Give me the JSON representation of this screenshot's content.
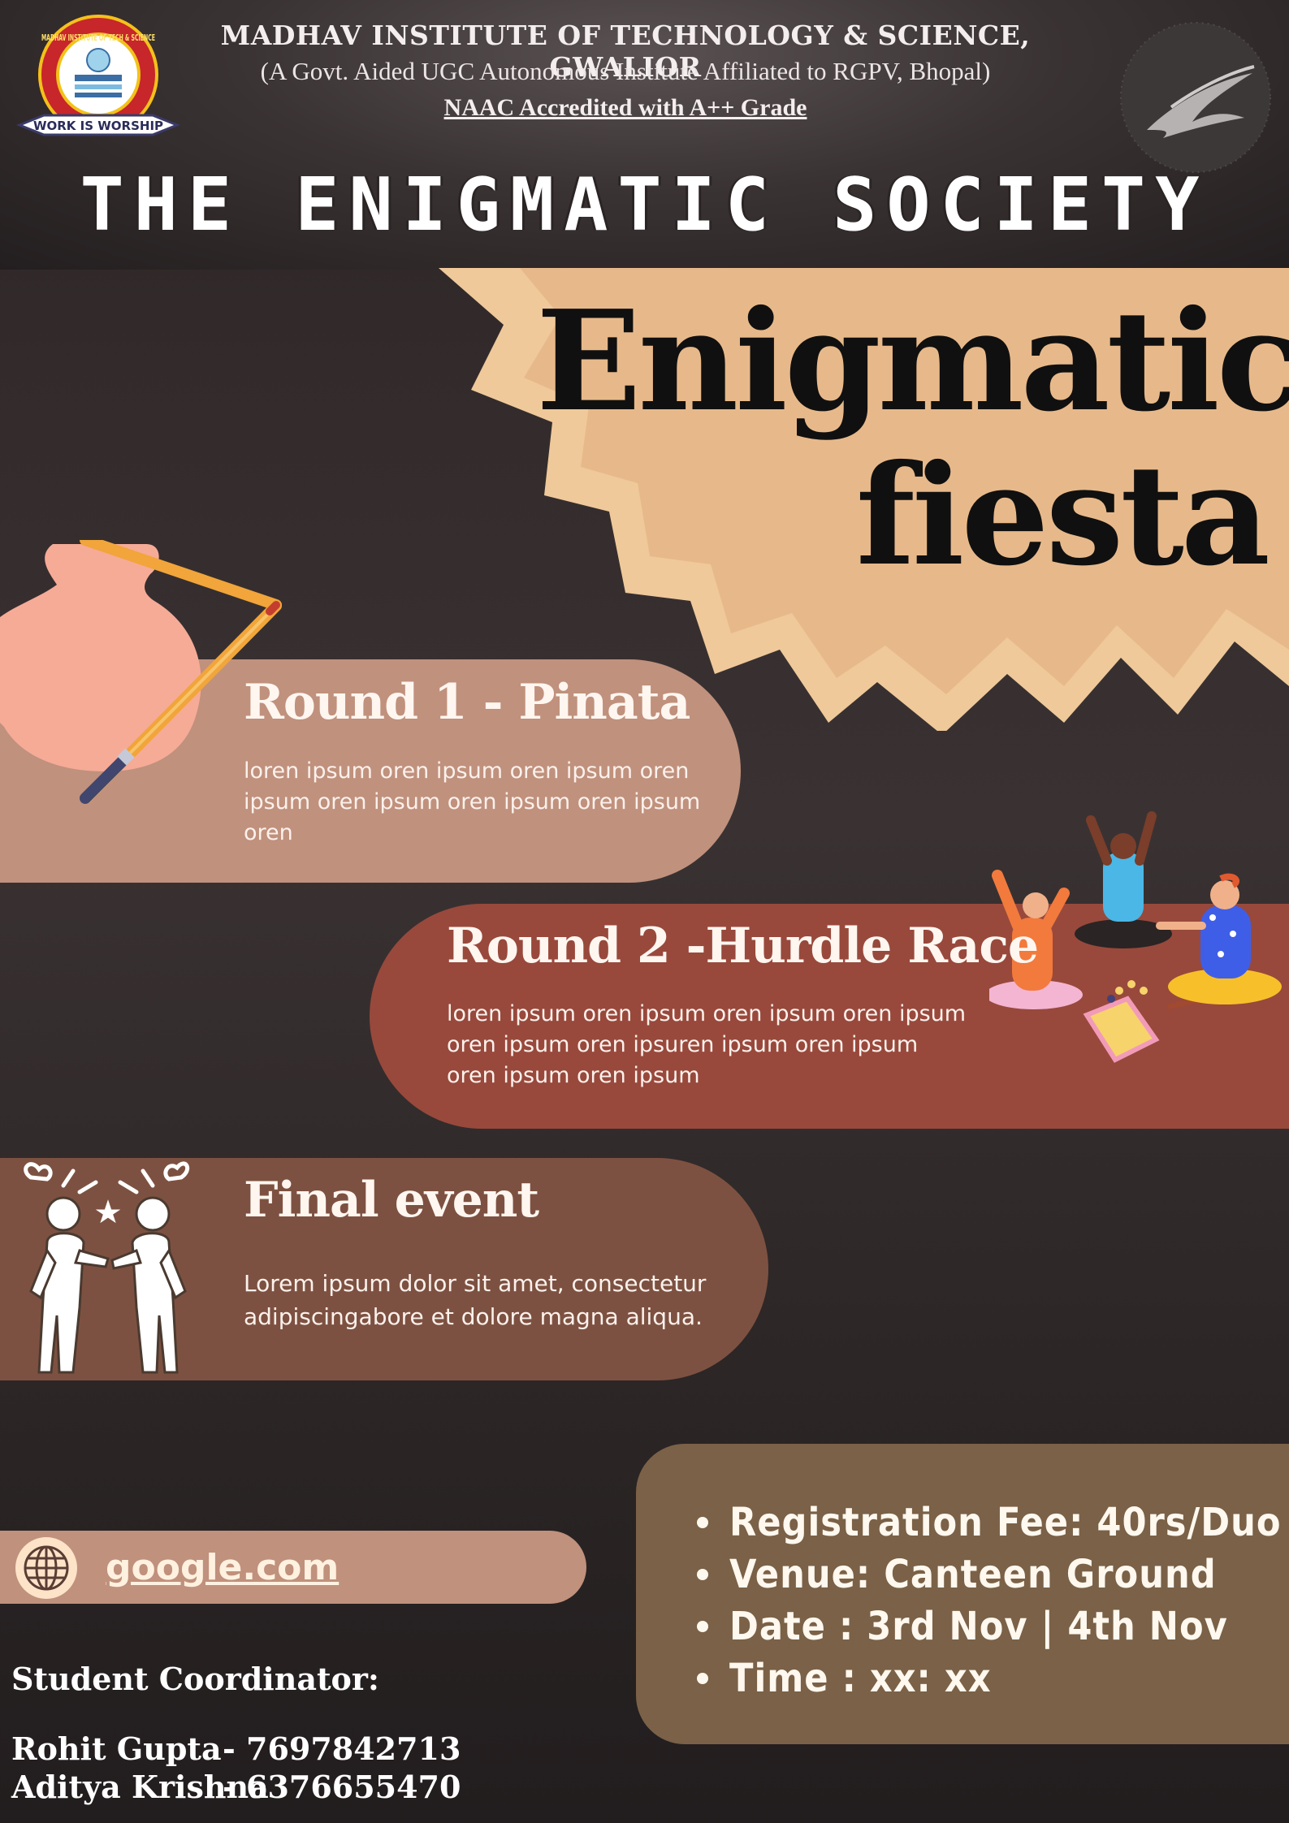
{
  "header": {
    "institute_name": "MADHAV INSTITUTE OF TECHNOLOGY & SCIENCE, GWALIOR",
    "institute_subtitle": "(A Govt. Aided UGC Autonomous Institute Affiliated to RGPV, Bhopal)",
    "accreditation": "NAAC Accredited with A++ Grade",
    "logo_ring_text": "MADHAV INSTITUTE OF TECH & SCIENCE",
    "logo_motto": "WORK IS WORSHIP",
    "society_name": "THE ENIGMATIC SOCIETY"
  },
  "event": {
    "title_line1": "Enigmatic",
    "title_line2": "fiesta"
  },
  "rounds": [
    {
      "title": "Round 1 - Pinata",
      "description": "loren ipsum oren ipsum oren ipsum oren ipsum oren ipsum oren ipsum oren ipsum oren",
      "icon": "pinata-pot-icon"
    },
    {
      "title": "Round 2 -Hurdle Race",
      "description": "loren ipsum oren ipsum oren ipsum oren ipsum oren ipsum oren ipsuren ipsum oren ipsum oren ipsum oren ipsum",
      "icon": "people-playing-icon"
    },
    {
      "title": "Final event",
      "description": "Lorem ipsum dolor sit amet, consectetur adipiscingabore et dolore magna aliqua.",
      "icon": "arguing-people-icon"
    }
  ],
  "details": [
    "Registration Fee: 40rs/Duo",
    "Venue: Canteen Ground",
    "Date : 3rd Nov | 4th Nov",
    "Time : xx: xx"
  ],
  "website": {
    "label": "google.com",
    "icon": "globe-icon"
  },
  "coordinators": {
    "heading": "Student Coordinator:",
    "people": [
      {
        "name": "Rohit Gupta",
        "phone": "- 7697842713"
      },
      {
        "name": "Aditya Krishna",
        "phone": "- 6376655470"
      }
    ]
  },
  "colors": {
    "background": "#2b2424",
    "starburst_outer": "#efc99a",
    "starburst_inner": "#e7b98a",
    "round1_pill": "#c0917d",
    "round2_pill": "#98493c",
    "final_pill": "#7d5141",
    "info_box": "#7a6147"
  }
}
